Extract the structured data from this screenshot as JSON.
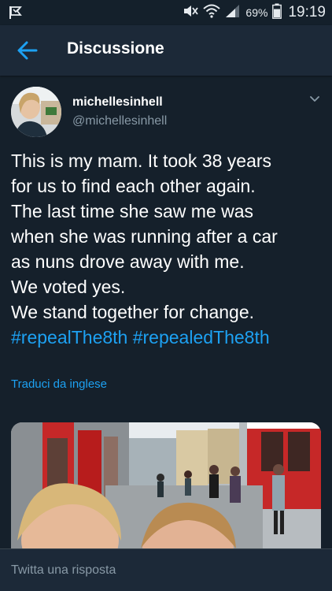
{
  "status_bar": {
    "app_icon": "flag-icon",
    "mute_icon": "mute-icon",
    "wifi_icon": "wifi-icon",
    "signal_icon": "signal-icon",
    "battery_percent": "69%",
    "battery_icon": "battery-icon",
    "time": "19:19"
  },
  "header": {
    "back_icon": "back-arrow-icon",
    "title": "Discussione"
  },
  "tweet": {
    "display_name": "michellesinhell",
    "handle": "@michellesinhell",
    "menu_icon": "chevron-down-icon",
    "text_lines": [
      "This is my mam. It took 38 years",
      "for us to find each other again.",
      "The last time she saw me was",
      "when she was running after a car",
      "as nuns drove away with me.",
      "We voted yes.",
      "We stand together for change."
    ],
    "hashtags": [
      "#repealThe8th",
      "#repealedThe8th"
    ],
    "translate_link": "Traduci da inglese"
  },
  "reply": {
    "placeholder": "Twitta una risposta"
  },
  "colors": {
    "background": "#15202b",
    "bar": "#1c2938",
    "accent": "#1da1f2",
    "muted": "#8899a6"
  }
}
